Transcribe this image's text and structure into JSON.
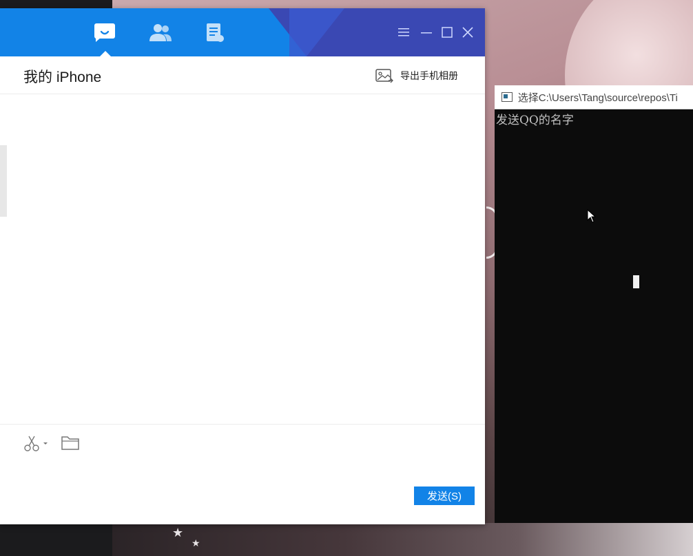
{
  "qq_window": {
    "nav_tabs": [
      {
        "name": "messages",
        "icon": "chat-bubble-icon",
        "active": true
      },
      {
        "name": "contacts",
        "icon": "contacts-icon",
        "active": false
      },
      {
        "name": "files",
        "icon": "file-doc-icon",
        "active": false
      }
    ],
    "window_controls": [
      "menu-icon",
      "minimize-icon",
      "maximize-icon",
      "close-icon"
    ],
    "chat_title": "我的 iPhone",
    "export_album_label": "导出手机相册",
    "toolbar": {
      "screenshot_icon": "scissors-icon",
      "folder_icon": "folder-icon"
    },
    "send_button_label": "发送(S)",
    "colors": {
      "header_blue": "#1283e7",
      "header_accent": "#3a48b3",
      "send_button": "#1283e7"
    }
  },
  "console_window": {
    "title": "选择C:\\Users\\Tang\\source\\repos\\Ti",
    "output_line": "发送QQ的名字"
  }
}
